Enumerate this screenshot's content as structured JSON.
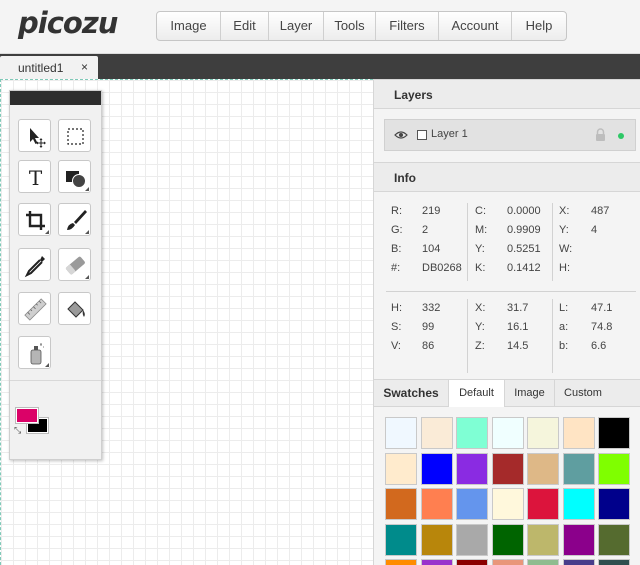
{
  "app": {
    "logo_text": "picozu"
  },
  "menu": [
    {
      "label": "Image",
      "w": 64
    },
    {
      "label": "Edit",
      "w": 48
    },
    {
      "label": "Layer",
      "w": 55
    },
    {
      "label": "Tools",
      "w": 52
    },
    {
      "label": "Filters",
      "w": 63
    },
    {
      "label": "Account",
      "w": 73
    },
    {
      "label": "Help",
      "w": 54
    }
  ],
  "document_tab": {
    "title": "untitled1",
    "close": "×"
  },
  "toolbox": {
    "tools": [
      {
        "name": "move-tool",
        "icon": "move-arrow-icon"
      },
      {
        "name": "marquee-tool",
        "icon": "marquee-icon"
      },
      {
        "name": "text-tool",
        "icon": "text-icon"
      },
      {
        "name": "shape-tool",
        "icon": "shapes-icon"
      },
      {
        "name": "crop-tool",
        "icon": "crop-icon"
      },
      {
        "name": "brush-tool",
        "icon": "brush-icon"
      },
      {
        "name": "eyedropper-tool",
        "icon": "eyedropper-icon"
      },
      {
        "name": "eraser-tool",
        "icon": "eraser-icon"
      },
      {
        "name": "ruler-tool",
        "icon": "ruler-icon"
      },
      {
        "name": "fill-tool",
        "icon": "paint-bucket-icon"
      },
      {
        "name": "spray-tool",
        "icon": "spray-can-icon"
      }
    ],
    "primary_color": "#DB0268",
    "secondary_color": "#000000"
  },
  "layers": {
    "title": "Layers",
    "items": [
      {
        "name": "Layer 1",
        "active_color": "#2ec866"
      }
    ]
  },
  "info": {
    "title": "Info",
    "rgb": [
      {
        "k": "R:",
        "v": "219"
      },
      {
        "k": "G:",
        "v": "2"
      },
      {
        "k": "B:",
        "v": "104"
      },
      {
        "k": "#:",
        "v": "DB0268"
      }
    ],
    "cmyk": [
      {
        "k": "C:",
        "v": "0.0000"
      },
      {
        "k": "M:",
        "v": "0.9909"
      },
      {
        "k": "Y:",
        "v": "0.5251"
      },
      {
        "k": "K:",
        "v": "0.1412"
      }
    ],
    "pos": [
      {
        "k": "X:",
        "v": "487"
      },
      {
        "k": "Y:",
        "v": "4"
      },
      {
        "k": "W:",
        "v": ""
      },
      {
        "k": "H:",
        "v": ""
      }
    ],
    "hsv": [
      {
        "k": "H:",
        "v": "332"
      },
      {
        "k": "S:",
        "v": "99"
      },
      {
        "k": "V:",
        "v": "86"
      }
    ],
    "xyz": [
      {
        "k": "X:",
        "v": "31.7"
      },
      {
        "k": "Y:",
        "v": "16.1"
      },
      {
        "k": "Z:",
        "v": "14.5"
      }
    ],
    "lab": [
      {
        "k": "L:",
        "v": "47.1"
      },
      {
        "k": "a:",
        "v": "74.8"
      },
      {
        "k": "b:",
        "v": "6.6"
      }
    ]
  },
  "swatches": {
    "tabs": [
      {
        "label": "Swatches"
      },
      {
        "label": "Default"
      },
      {
        "label": "Image"
      },
      {
        "label": "Custom"
      }
    ],
    "colors": [
      "#f0f8ff",
      "#faebd7",
      "#7fffd4",
      "#f0ffff",
      "#f5f5dc",
      "#ffe4c4",
      "#000000",
      "#ffebcd",
      "#0000ff",
      "#8a2be2",
      "#a52a2a",
      "#deb887",
      "#5f9ea0",
      "#7fff00",
      "#d2691e",
      "#ff7f50",
      "#6495ed",
      "#fff8dc",
      "#dc143c",
      "#00ffff",
      "#00008b",
      "#008b8b",
      "#b8860b",
      "#a9a9a9",
      "#006400",
      "#bdb76b",
      "#8b008b",
      "#556b2f",
      "#ff8c00",
      "#9932cc",
      "#8b0000",
      "#e9967a",
      "#8fbc8f",
      "#483d8b",
      "#2f4f4f"
    ]
  }
}
